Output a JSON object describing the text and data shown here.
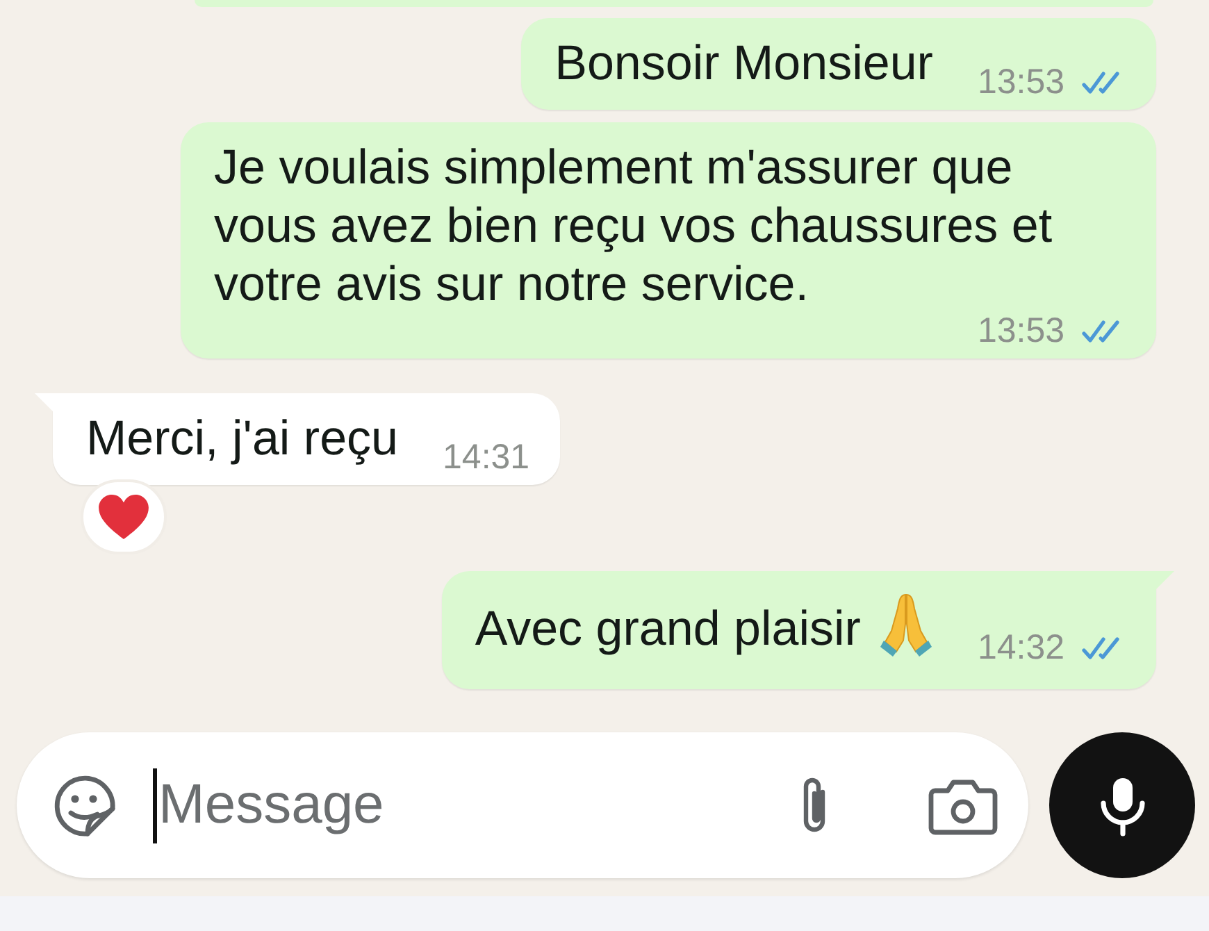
{
  "conversation": {
    "messages": [
      {
        "kind": "cut_off",
        "outgoing": true
      },
      {
        "kind": "text",
        "outgoing": true,
        "text": "Bonsoir Monsieur",
        "time": "13:53",
        "read": true,
        "tail": false
      },
      {
        "kind": "text",
        "outgoing": true,
        "text": "Je voulais simplement m'assurer que vous avez bien reçu vos chaussures et votre avis sur notre service.",
        "time": "13:53",
        "read": true,
        "tail": false
      },
      {
        "kind": "text",
        "outgoing": false,
        "text": "Merci, j'ai reçu",
        "time": "14:31",
        "tail": true,
        "reactions": [
          {
            "kind": "heart"
          }
        ]
      },
      {
        "kind": "text",
        "outgoing": true,
        "text": "Avec grand plaisir",
        "emoji": {
          "kind": "folded_hands"
        },
        "time": "14:32",
        "read": true,
        "tail": true
      }
    ]
  },
  "composer": {
    "placeholder": "Message",
    "focused": true
  }
}
